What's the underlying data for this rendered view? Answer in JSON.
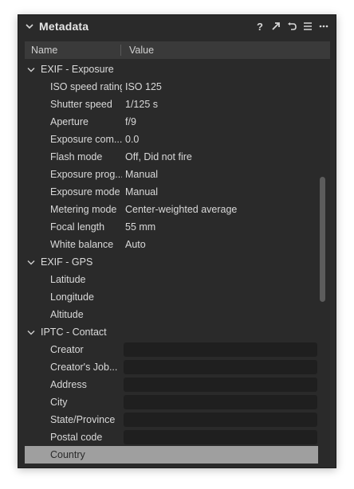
{
  "panel": {
    "title": "Metadata",
    "tools": [
      "help-icon",
      "expand-icon",
      "reset-icon",
      "list-icon",
      "more-icon"
    ]
  },
  "header": {
    "name": "Name",
    "value": "Value"
  },
  "groups": [
    {
      "label": "EXIF - Exposure",
      "rows": [
        {
          "name": "ISO speed rating",
          "value": "ISO 125"
        },
        {
          "name": "Shutter speed",
          "value": "1/125 s"
        },
        {
          "name": "Aperture",
          "value": "f/9"
        },
        {
          "name": "Exposure com...",
          "value": "0.0"
        },
        {
          "name": "Flash mode",
          "value": "Off, Did not fire"
        },
        {
          "name": "Exposure prog...",
          "value": "Manual"
        },
        {
          "name": "Exposure mode",
          "value": "Manual"
        },
        {
          "name": "Metering mode",
          "value": "Center-weighted average"
        },
        {
          "name": "Focal length",
          "value": "55 mm"
        },
        {
          "name": "White balance",
          "value": "Auto"
        }
      ]
    },
    {
      "label": "EXIF - GPS",
      "rows": [
        {
          "name": "Latitude",
          "value": ""
        },
        {
          "name": "Longitude",
          "value": ""
        },
        {
          "name": "Altitude",
          "value": ""
        }
      ]
    },
    {
      "label": "IPTC - Contact",
      "rows": [
        {
          "name": "Creator",
          "value": ""
        },
        {
          "name": "Creator's Job...",
          "value": ""
        },
        {
          "name": "Address",
          "value": ""
        },
        {
          "name": "City",
          "value": ""
        },
        {
          "name": "State/Province",
          "value": ""
        },
        {
          "name": "Postal code",
          "value": ""
        },
        {
          "name": "Country",
          "value": ""
        }
      ]
    }
  ]
}
